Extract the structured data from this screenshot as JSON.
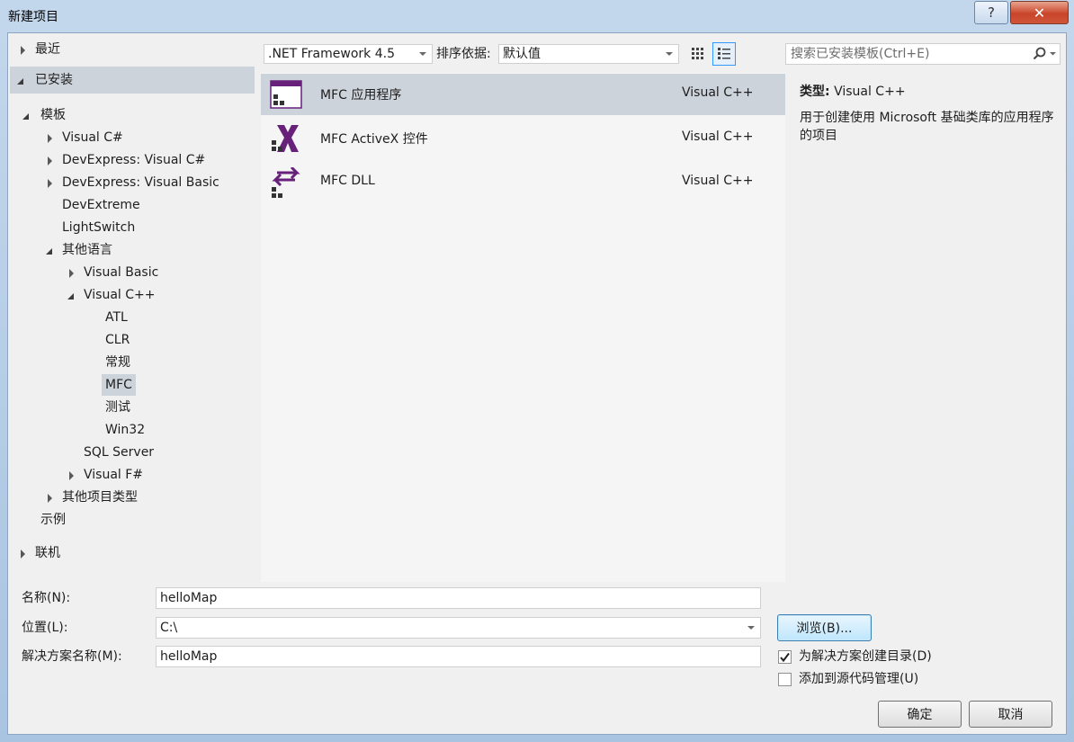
{
  "window": {
    "title": "新建项目",
    "help": "?",
    "close": "✕"
  },
  "tree": {
    "recent": "最近",
    "installed": "已安装",
    "templates": "模板",
    "visual_csharp": "Visual C#",
    "devexpress_csharp": "DevExpress: Visual C#",
    "devexpress_vb": "DevExpress: Visual Basic",
    "devextreme": "DevExtreme",
    "lightswitch": "LightSwitch",
    "other_languages": "其他语言",
    "visual_basic": "Visual Basic",
    "visual_cpp": "Visual C++",
    "atl": "ATL",
    "clr": "CLR",
    "general": "常规",
    "mfc": "MFC",
    "test": "测试",
    "win32": "Win32",
    "sql_server": "SQL Server",
    "visual_fsharp": "Visual F#",
    "other_project_types": "其他项目类型",
    "samples": "示例",
    "online": "联机"
  },
  "toolbar": {
    "framework": ".NET Framework 4.5",
    "sort_label": "排序依据:",
    "sort_value": "默认值",
    "search_placeholder": "搜索已安装模板(Ctrl+E)"
  },
  "templates": [
    {
      "name": "MFC 应用程序",
      "lang": "Visual C++"
    },
    {
      "name": "MFC ActiveX 控件",
      "lang": "Visual C++"
    },
    {
      "name": "MFC DLL",
      "lang": "Visual C++"
    }
  ],
  "details": {
    "type_label": "类型:",
    "type_value": "Visual C++",
    "description": "用于创建使用 Microsoft 基础类库的应用程序的项目"
  },
  "form": {
    "name_label": "名称(N):",
    "name_value": "helloMap",
    "location_label": "位置(L):",
    "location_value": "C:\\",
    "solution_label": "解决方案名称(M):",
    "solution_value": "helloMap",
    "browse": "浏览(B)...",
    "create_dir": "为解决方案创建目录(D)",
    "create_dir_checked": true,
    "add_source_control": "添加到源代码管理(U)",
    "add_source_control_checked": false,
    "ok": "确定",
    "cancel": "取消"
  },
  "colors": {
    "mfc_purple": "#68217a",
    "selection": "#cdd3db",
    "focus_border": "#3399ff"
  }
}
